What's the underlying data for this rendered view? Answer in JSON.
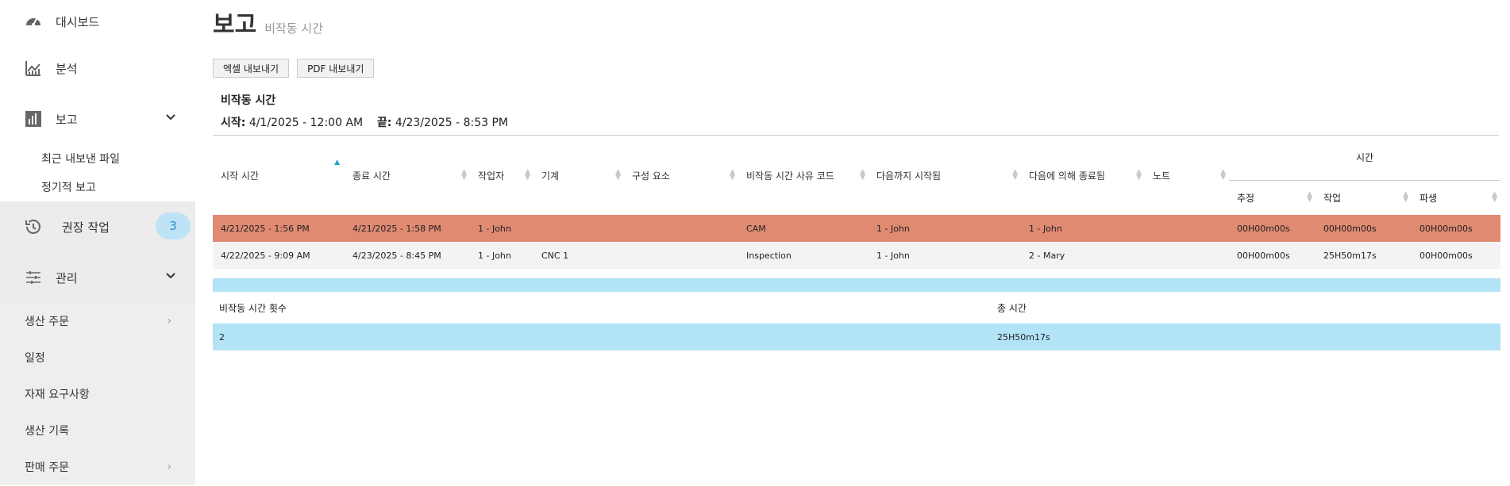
{
  "sidebar": {
    "dashboard": "대시보드",
    "analytics": "분석",
    "reports": "보고",
    "reports_sub": [
      "최근 내보낸 파일",
      "정기적 보고"
    ],
    "recommended": "권장 작업",
    "recommended_count": "3",
    "management": "관리",
    "management_sub": [
      {
        "label": "생산 주문",
        "has_arrow": true
      },
      {
        "label": "일정",
        "has_arrow": false
      },
      {
        "label": "자재 요구사항",
        "has_arrow": false
      },
      {
        "label": "생산 기록",
        "has_arrow": false
      },
      {
        "label": "판매 주문",
        "has_arrow": true
      }
    ]
  },
  "header": {
    "title": "보고",
    "subtitle": "비작동 시간"
  },
  "toolbar": {
    "excel": "엑셀 내보내기",
    "pdf": "PDF 내보내기"
  },
  "report": {
    "title": "비작동 시간",
    "start_label": "시작:",
    "start_value": "4/1/2025 - 12:00 AM",
    "end_label": "끝:",
    "end_value": "4/23/2025 - 8:53 PM"
  },
  "table": {
    "columns": [
      "시작 시간",
      "종료 시간",
      "작업자",
      "기계",
      "구성 요소",
      "비작동 시간 사유 코드",
      "다음까지 시작됨",
      "다음에 의해 종료됨",
      "노트"
    ],
    "time_group": "시간",
    "time_columns": [
      "추정",
      "작업",
      "파생"
    ],
    "rows": [
      [
        "4/21/2025 - 1:56 PM",
        "4/21/2025 - 1:58 PM",
        "1 - John",
        "",
        "",
        "CAM",
        "1 - John",
        "1 - John",
        "",
        "00H00m00s",
        "00H00m00s",
        "00H00m00s"
      ],
      [
        "4/22/2025 - 9:09 AM",
        "4/23/2025 - 8:45 PM",
        "1 - John",
        "CNC 1",
        "",
        "Inspection",
        "1 - John",
        "2 - Mary",
        "",
        "00H00m00s",
        "25H50m17s",
        "00H00m00s"
      ]
    ]
  },
  "summary": {
    "count_label": "비작동 시간 횟수",
    "total_label": "총 시간",
    "count_value": "2",
    "total_value": "25H50m17s"
  },
  "colors": {
    "highlight_row": "#e08a72",
    "summary": "#b3e3f7",
    "badge": "#bfe3f6",
    "sort_active": "#1fa3c9"
  }
}
